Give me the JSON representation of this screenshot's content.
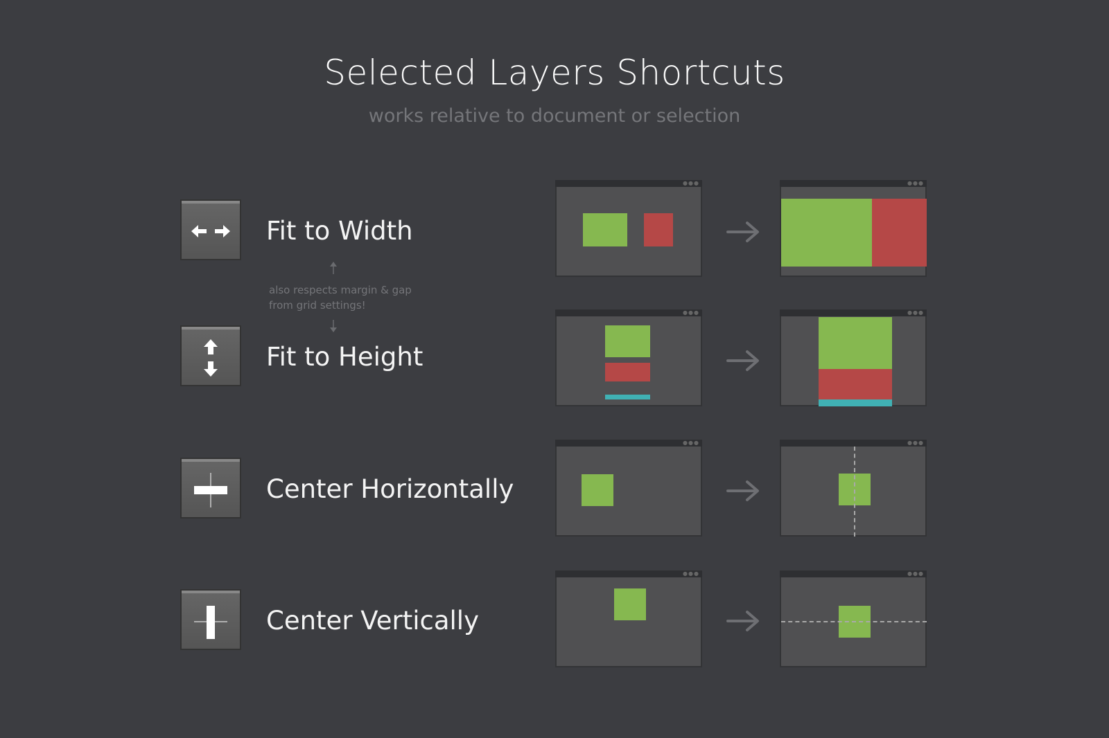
{
  "header": {
    "title": "Selected Layers Shortcuts",
    "subtitle": "works relative to document or selection"
  },
  "note": {
    "line1": "also respects margin & gap",
    "line2": "from grid settings!"
  },
  "colors": {
    "background": "#3c3d41",
    "panel": "#505052",
    "panel_header": "#2e2f32",
    "green": "#86b850",
    "red": "#b54847",
    "teal": "#40b1b4",
    "arrow": "#6e6f73",
    "guide": "#a9a9a9"
  },
  "shortcuts": [
    {
      "label": "Fit to Width",
      "icon": "arrows-horizontal-icon"
    },
    {
      "label": "Fit to Height",
      "icon": "arrows-vertical-icon"
    },
    {
      "label": "Center Horizontally",
      "icon": "center-horizontal-icon"
    },
    {
      "label": "Center Vertically",
      "icon": "center-vertical-icon"
    }
  ],
  "panel_dots": "●●●"
}
